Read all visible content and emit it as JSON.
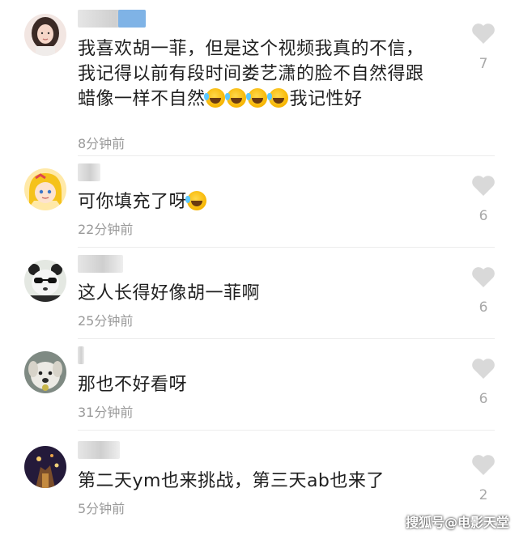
{
  "comments": [
    {
      "text_part1": "我喜欢胡一菲，但是这个视频我真的不信，我记得以前有段时间娄艺潇的脸不自然得跟蜡像一样不自然",
      "text_part2": "我记性好",
      "time": "8分钟前",
      "likes": "7",
      "avatar": "woman-avatar"
    },
    {
      "text": "可你填充了呀",
      "time": "22分钟前",
      "likes": "6",
      "avatar": "anime-girl-avatar"
    },
    {
      "text": "这人长得好像胡一菲啊",
      "time": "25分钟前",
      "likes": "6",
      "avatar": "panda-sunglasses-avatar"
    },
    {
      "text": "那也不好看呀",
      "time": "31分钟前",
      "likes": "6",
      "avatar": "dog-avatar"
    },
    {
      "text": "第二天ym也来挑战，第三天ab也来了",
      "time": "5分钟前",
      "likes": "2",
      "avatar": "dark-photo-avatar"
    }
  ],
  "emoji_name": "laughing-crying-emoji",
  "watermark": "搜狐号@电影天堂",
  "colors": {
    "text": "#1f1f1f",
    "time": "#9a9a9a",
    "like_icon": "#d9d9d9",
    "divider": "#ececec"
  }
}
